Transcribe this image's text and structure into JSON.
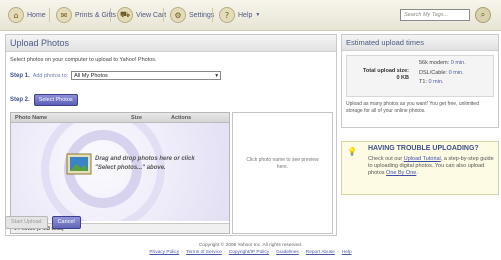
{
  "nav": {
    "items": [
      {
        "label": "Home",
        "icon": "home-icon"
      },
      {
        "label": "Prints & Gifts",
        "icon": "gift-icon"
      },
      {
        "label": "View Cart",
        "icon": "cart-icon"
      },
      {
        "label": "Settings",
        "icon": "gear-icon"
      },
      {
        "label": "Help",
        "icon": "help-icon"
      }
    ],
    "search_placeholder": "Search My Tags..."
  },
  "upload": {
    "title": "Upload Photos",
    "intro": "Select photos on your computer to upload to Yahoo! Photos.",
    "step1_label": "Step 1.",
    "step1_text": "Add photos to:",
    "album_value": "All My Photos",
    "step2_label": "Step 2.",
    "select_button": "Select Photos",
    "columns": [
      "Photo Name",
      "Size",
      "Actions"
    ],
    "drop_text": "Drag and drop photos here or click \"Select photos...\" above.",
    "footer_text": "0 Photos (0 MB total)",
    "preview_text": "Click photo name to see preview here.",
    "start_button": "Start Upload",
    "cancel_button": "Cancel"
  },
  "estimate": {
    "title": "Estimated upload times",
    "size_label": "Total upload size:",
    "size_value": "0 KB",
    "rates": [
      {
        "name": "56k modem:",
        "time": "0 min."
      },
      {
        "name": "DSL/Cable:",
        "time": "0 min."
      },
      {
        "name": "T1:",
        "time": "0 min."
      }
    ],
    "note": "Upload as many photos as you want! You get free, unlimited storage for all of your online photos."
  },
  "trouble": {
    "title": "HAVING TROUBLE UPLOADING?",
    "text_a": "Check out our",
    "link_tutorial": "Upload Tutorial",
    "text_b": ", a step-by-step guide to uploading digital photos. You can also upload photos",
    "link_one": "One By One",
    "text_c": "."
  },
  "footer": {
    "copyright": "Copyright © 2006 Yahoo! Inc. All rights reserved.",
    "links": [
      "Privacy Policy",
      "Terms of Service",
      "Copyright/IP Policy",
      "Guidelines",
      "Report Abuse",
      "Help"
    ]
  },
  "colors": {
    "accent": "#5c60b8",
    "heading": "#4a5a86",
    "link": "#3d4fae"
  }
}
